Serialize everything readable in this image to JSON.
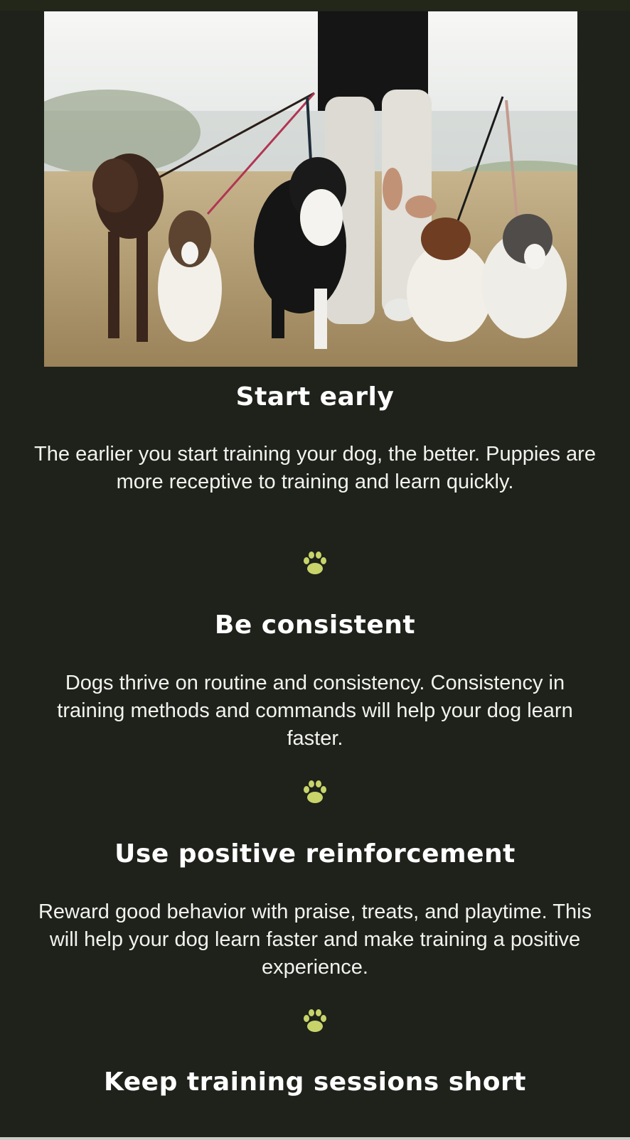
{
  "hero": {
    "image_alt": "person walking five dogs on leashes in a field"
  },
  "tips": [
    {
      "heading": "Start early",
      "body": "The earlier you start training your dog, the better. Puppies are more receptive to training and learn quickly."
    },
    {
      "heading": "Be consistent",
      "body": "Dogs thrive on routine and consistency. Consistency in training methods and commands will help your dog learn faster."
    },
    {
      "heading": "Use positive reinforcement",
      "body": "Reward good behavior with praise, treats, and playtime. This will help your dog learn faster and make training a positive experience."
    },
    {
      "heading": "Keep training sessions short",
      "body": ""
    }
  ],
  "colors": {
    "background": "#1e221b",
    "text": "#ffffff",
    "accent_paw": "#c8d46a"
  },
  "icons": {
    "divider": "paw-icon"
  }
}
